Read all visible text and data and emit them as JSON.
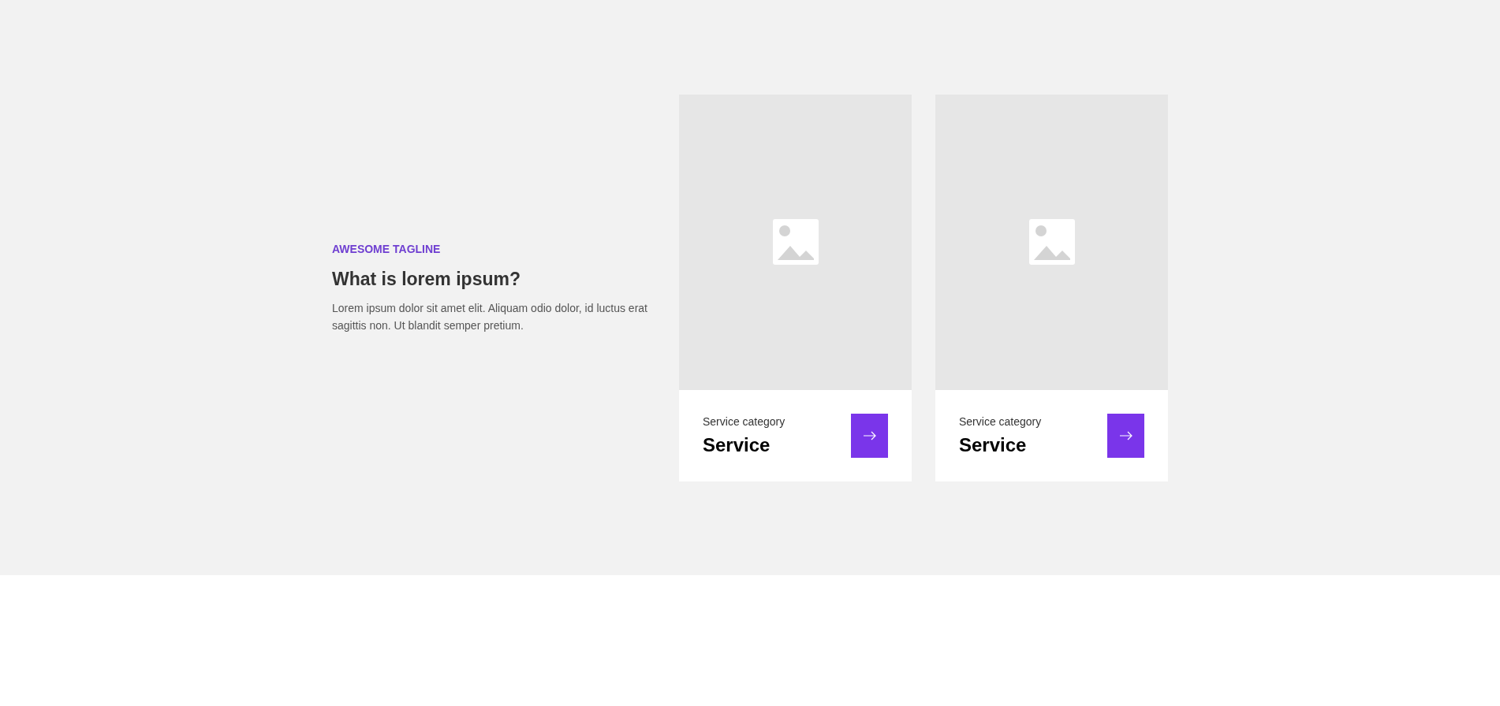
{
  "intro": {
    "tagline": "AWESOME TAGLINE",
    "heading": "What is lorem ipsum?",
    "body": "Lorem ipsum dolor sit amet elit. Aliquam odio dolor, id luctus erat sagittis non. Ut blandit semper pretium."
  },
  "cards": [
    {
      "image": {
        "kind": "placeholder"
      },
      "category": "Service category",
      "title": "Service"
    },
    {
      "image": {
        "kind": "placeholder"
      },
      "category": "Service category",
      "title": "Service"
    }
  ]
}
